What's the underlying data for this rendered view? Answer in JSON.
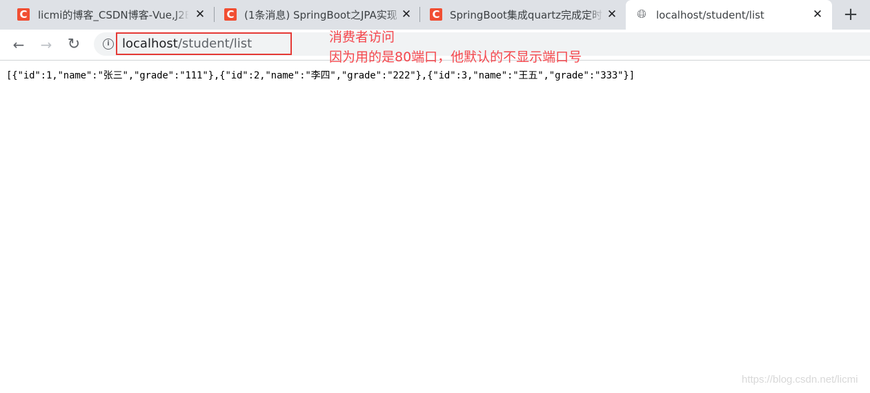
{
  "tabs": [
    {
      "title": "licmi的博客_CSDN博客-Vue,J2E",
      "favicon": "csdn-icon"
    },
    {
      "title": "(1条消息) SpringBoot之JPA实现",
      "favicon": "csdn-icon"
    },
    {
      "title": "SpringBoot集成quartz完成定时",
      "favicon": "csdn-icon"
    },
    {
      "title": "localhost/student/list",
      "favicon": "globe-icon"
    }
  ],
  "tab_close_glyph": "✕",
  "new_tab_glyph": "+",
  "favicon_letter": "C",
  "toolbar": {
    "back_glyph": "←",
    "forward_glyph": "→",
    "reload_glyph": "↻",
    "info_glyph": "i"
  },
  "address": {
    "host": "localhost",
    "path": "/student/list"
  },
  "annotations": {
    "line1": "消费者访问",
    "line2": "因为用的是80端口，他默认的不显示端口号"
  },
  "page_content": "[{\"id\":1,\"name\":\"张三\",\"grade\":\"111\"},{\"id\":2,\"name\":\"李四\",\"grade\":\"222\"},{\"id\":3,\"name\":\"王五\",\"grade\":\"333\"}]",
  "watermark": "https://blog.csdn.net/licmi",
  "colors": {
    "csdn_red": "#f14e32",
    "annotation_red": "#f4474d",
    "tabstrip_bg": "#dee1e6"
  }
}
